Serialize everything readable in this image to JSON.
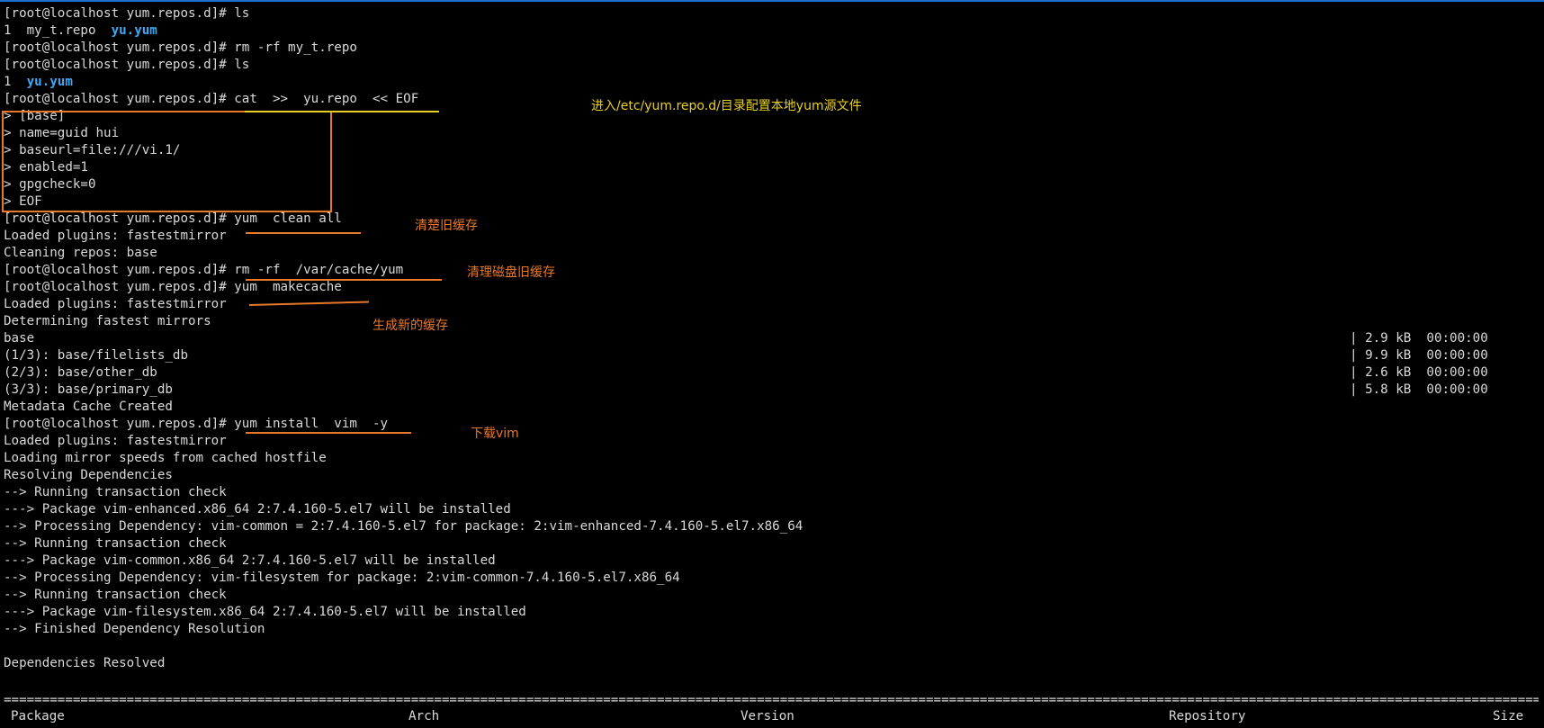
{
  "terminal": {
    "lines": [
      "[root@localhost yum.repos.d]# ls",
      "",
      "[root@localhost yum.repos.d]# rm -rf my_t.repo",
      "[root@localhost yum.repos.d]# ls",
      "",
      "[root@localhost yum.repos.d]# cat  >>  yu.repo  << EOF",
      "> [base]",
      "> name=guid hui",
      "> baseurl=file:///vi.1/",
      "> enabled=1",
      "> gpgcheck=0",
      "> EOF",
      "[root@localhost yum.repos.d]# yum  clean all",
      "Loaded plugins: fastestmirror",
      "Cleaning repos: base",
      "[root@localhost yum.repos.d]# rm -rf  /var/cache/yum",
      "[root@localhost yum.repos.d]# yum  makecache",
      "Loaded plugins: fastestmirror",
      "Determining fastest mirrors",
      "base",
      "(1/3): base/filelists_db",
      "(2/3): base/other_db",
      "(3/3): base/primary_db",
      "Metadata Cache Created",
      "[root@localhost yum.repos.d]# yum install  vim  -y",
      "Loaded plugins: fastestmirror",
      "Loading mirror speeds from cached hostfile",
      "Resolving Dependencies",
      "--> Running transaction check",
      "---> Package vim-enhanced.x86_64 2:7.4.160-5.el7 will be installed",
      "--> Processing Dependency: vim-common = 2:7.4.160-5.el7 for package: 2:vim-enhanced-7.4.160-5.el7.x86_64",
      "--> Running transaction check",
      "---> Package vim-common.x86_64 2:7.4.160-5.el7 will be installed",
      "--> Processing Dependency: vim-filesystem for package: 2:vim-common-7.4.160-5.el7.x86_64",
      "--> Running transaction check",
      "---> Package vim-filesystem.x86_64 2:7.4.160-5.el7 will be installed",
      "--> Finished Dependency Resolution",
      "",
      "Dependencies Resolved"
    ],
    "ls1": {
      "plain": "1  my_t.repo  ",
      "highlight": "yu.yum"
    },
    "ls2": {
      "plain": "1  ",
      "highlight": "yu.yum"
    },
    "downloads": [
      "| 2.9 kB  00:00:00",
      "| 9.9 kB  00:00:00",
      "| 2.6 kB  00:00:00",
      "| 5.8 kB  00:00:00"
    ],
    "separator": "==========================================================================================================================================================================================================================================================",
    "table_header": {
      "package": "Package",
      "arch": "Arch",
      "version": "Version",
      "repository": "Repository",
      "size": "Size"
    }
  },
  "annotations": {
    "repo_config": "进入/etc/yum.repo.d/目录配置本地yum源文件",
    "clean_cache": "清楚旧缓存",
    "clean_disk_cache": "清理磁盘旧缓存",
    "new_cache": "生成新的缓存",
    "install_vim": "下载vim"
  },
  "colors": {
    "background": "#000000",
    "text": "#d9d9d9",
    "highlight": "#3fa9f5",
    "annotation_yellow": "#e8d020",
    "annotation_orange": "#e8782a",
    "border_blue": "#1f6fd1"
  }
}
